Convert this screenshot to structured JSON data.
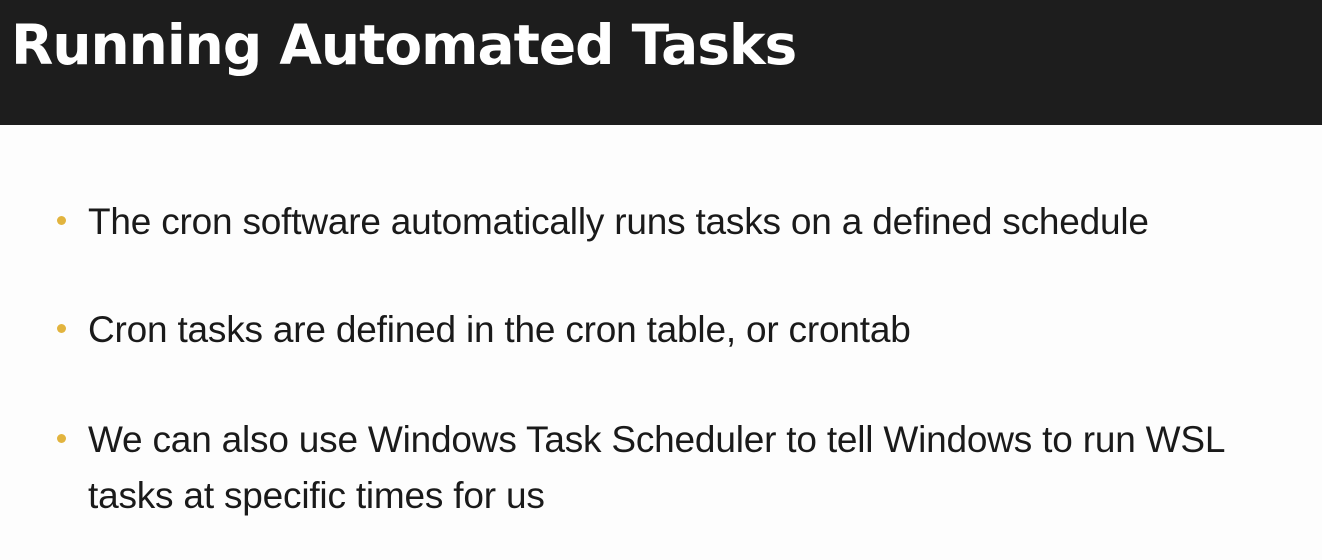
{
  "slide": {
    "title": "Running Automated Tasks",
    "bullets": [
      "The cron software automatically runs tasks on a defined schedule",
      "Cron tasks are defined in the cron table, or crontab",
      "We can also use Windows Task Scheduler to tell Windows to run WSL tasks at specific times for us"
    ]
  },
  "colors": {
    "title_bar": "#1d1d1d",
    "title_text": "#ffffff",
    "bullet_marker": "#e2b43e",
    "body_text": "#1a1a1a",
    "background": "#fdfdfd"
  }
}
